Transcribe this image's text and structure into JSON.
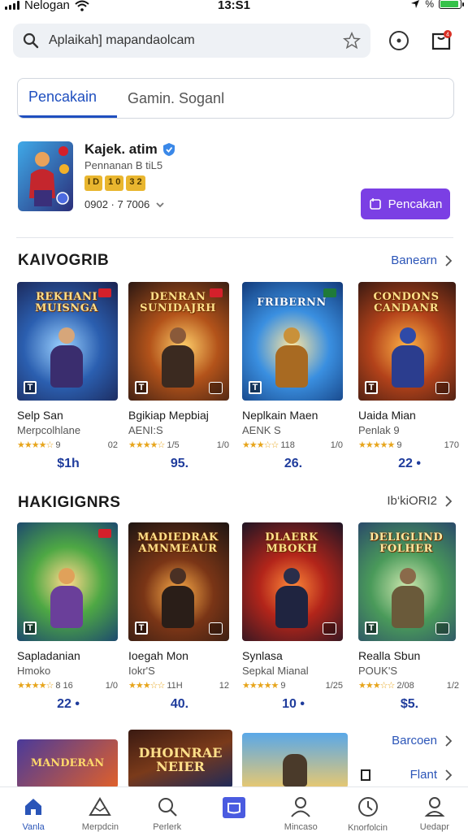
{
  "status_bar": {
    "carrier": "Nelogan",
    "time": "13:S1"
  },
  "search": {
    "query": "Aplaikah] mapandaolcam"
  },
  "tabs": [
    {
      "label": "Pencakain",
      "active": true
    },
    {
      "label": "Gamin. Soganl",
      "active": false
    }
  ],
  "featured": {
    "title": "Kajek. atim",
    "subtitle": "Pennanan B tiL5",
    "chips": [
      "I D",
      "1 0",
      "3 2"
    ],
    "meta": "0902 · 7 7006",
    "button_label": "Pencakan"
  },
  "sections": [
    {
      "title": "KAIVOGRIB",
      "link": "Banearn",
      "cards": [
        {
          "art_title": "REKHANI MUISNGA",
          "name": "Selp San",
          "sub": "Merpcolhlane",
          "stars": "★★★★☆",
          "rating_a": "9",
          "rating_b": "0⁡2",
          "price": "$1h"
        },
        {
          "art_title": "DENRAN SUNIDAJRH",
          "name": "Bgikiap Mepbiaj",
          "sub": "AENI:S",
          "stars": "★★★★☆",
          "rating_a": "1/5",
          "rating_b": "1/0",
          "price": "95."
        },
        {
          "art_title": "FRIBERNN",
          "name": "Neplkain Maen",
          "sub": "AENK S",
          "stars": "★★★☆☆",
          "rating_a": "118",
          "rating_b": "1/0",
          "price": "26."
        },
        {
          "art_title": "CONDONS CANDANR",
          "name": "Uaida Mian",
          "sub": "Penlak 9",
          "stars": "★★★★★",
          "rating_a": "9",
          "rating_b": "170",
          "price": "22 •"
        }
      ]
    },
    {
      "title": "HAKIGIGNRS",
      "link": "Ib‘kiORI2",
      "cards": [
        {
          "art_title": "",
          "name": "Sapladanian",
          "sub": "Hmoko",
          "stars": "★★★★☆",
          "rating_a": "8 16",
          "rating_b": "1/0",
          "price": "22 •"
        },
        {
          "art_title": "MADIEDRAK AMNMEAUR",
          "name": "Ioegah Mon",
          "sub": "Iokr'S",
          "stars": "★★★☆☆",
          "rating_a": "11H",
          "rating_b": "1⁡2",
          "price": "40."
        },
        {
          "art_title": "DLAERK MBOKH",
          "name": "Synlasa",
          "sub": "Sepkal Mianal",
          "stars": "★★★★★",
          "rating_a": "9",
          "rating_b": "1/25",
          "price": "10 •"
        },
        {
          "art_title": "DELIGLIND FOLHER",
          "name": "Realla Sbun",
          "sub": "POUK'S",
          "stars": "★★★☆☆",
          "rating_a": "2/08",
          "rating_b": "1/2",
          "price": "$5."
        }
      ]
    }
  ],
  "third_row": {
    "cards": [
      {
        "art_title": "MANDERAN"
      },
      {
        "art_title": "DHOINRAE NEIER"
      },
      {
        "art_title": ""
      }
    ],
    "link_top": "Barcoen",
    "link_bottom": "Flant"
  },
  "bottom_nav": [
    {
      "label": "Vanla",
      "icon": "home-icon",
      "active": true
    },
    {
      "label": "Merpdcin",
      "icon": "mountain-icon",
      "active": false
    },
    {
      "label": "Perlerk",
      "icon": "search-icon",
      "active": false
    },
    {
      "label": "",
      "icon": "tablet-icon",
      "active": false
    },
    {
      "label": "Mincaso",
      "icon": "person-icon",
      "active": false
    },
    {
      "label": "Knorfolcin",
      "icon": "history-icon",
      "active": false
    },
    {
      "label": "Uedapr",
      "icon": "account-icon",
      "active": false
    }
  ],
  "colors": {
    "accent": "#1f4fbf",
    "button": "#7b3fe4",
    "price": "#1f3c9c",
    "star": "#e7a51c"
  }
}
